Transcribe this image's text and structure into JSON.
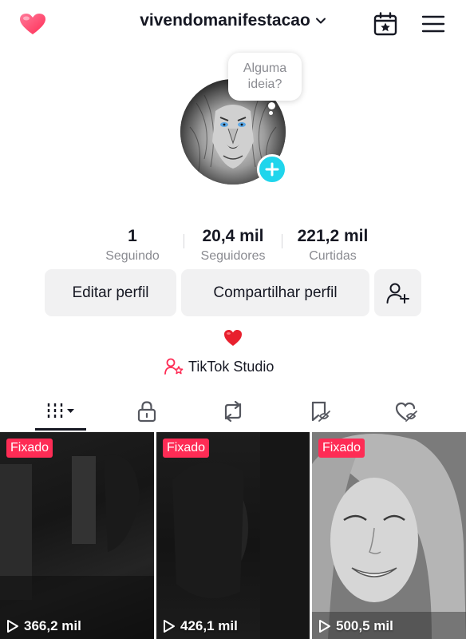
{
  "header": {
    "username": "vivendomanifestacao"
  },
  "avatar": {
    "bubble_line1": "Alguma",
    "bubble_line2": "ideia?"
  },
  "stats": [
    {
      "value": "1",
      "label": "Seguindo"
    },
    {
      "value": "20,4 mil",
      "label": "Seguidores"
    },
    {
      "value": "221,2 mil",
      "label": "Curtidas"
    }
  ],
  "actions": {
    "edit_label": "Editar perfil",
    "share_label": "Compartilhar perfil"
  },
  "bio": {
    "emoji": "❤️",
    "studio_label": "TikTok Studio"
  },
  "tabs": [
    {
      "icon": "videos-grid-icon",
      "active": true
    },
    {
      "icon": "lock-icon",
      "active": false
    },
    {
      "icon": "repost-icon",
      "active": false
    },
    {
      "icon": "favorites-hidden-icon",
      "active": false
    },
    {
      "icon": "liked-hidden-icon",
      "active": false
    }
  ],
  "videos": [
    {
      "pinned_label": "Fixado",
      "views": "366,2 mil"
    },
    {
      "pinned_label": "Fixado",
      "views": "426,1 mil"
    },
    {
      "pinned_label": "Fixado",
      "views": "500,5 mil"
    }
  ],
  "colors": {
    "accent": "#fe2c55",
    "add_badge": "#20d5ec",
    "button_bg": "#f1f1f2",
    "secondary_text": "#8a8b91"
  }
}
